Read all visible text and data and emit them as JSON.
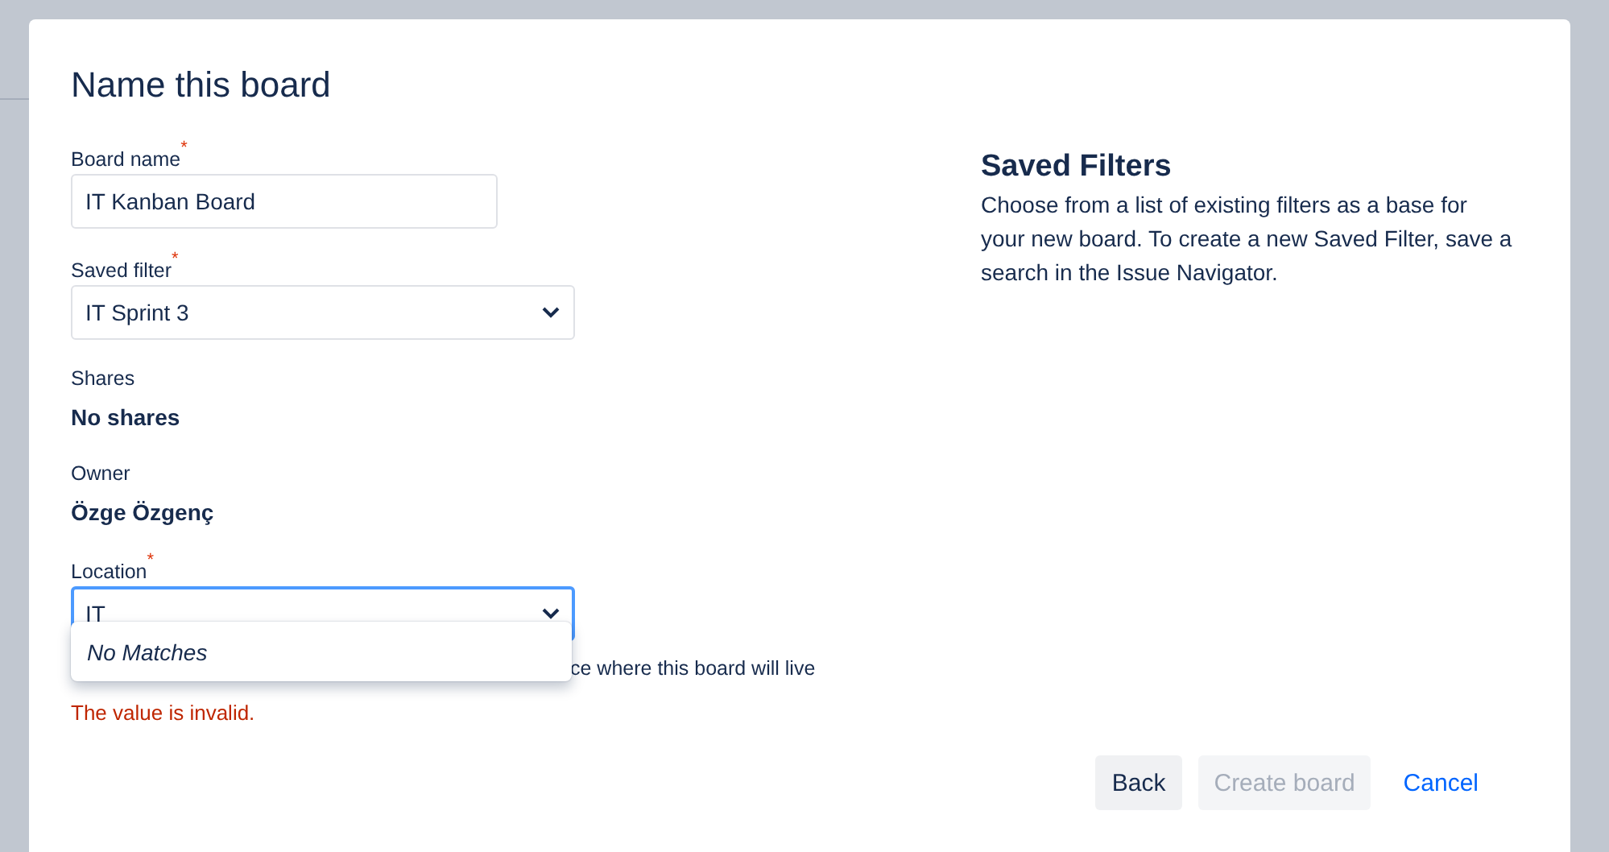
{
  "dialog": {
    "title": "Name this board"
  },
  "fields": [
    {
      "kind": "text",
      "label": "Board name",
      "marker": "*",
      "value": "IT Kanban Board"
    },
    {
      "kind": "select",
      "label": "Saved filter",
      "marker": "*",
      "value": "IT Sprint 3"
    },
    {
      "kind": "readonly",
      "label": "Shares",
      "value": "No shares"
    },
    {
      "kind": "readonly",
      "label": "Owner",
      "value": "Özge Özgenç"
    },
    {
      "kind": "select",
      "label": "Location",
      "marker": "*",
      "focused": true,
      "value": "IT",
      "dropdown": {
        "message": "No Matches"
      },
      "help": "ce where this board will live",
      "error": "The value is invalid."
    }
  ],
  "info": {
    "title": "Saved Filters",
    "text": "Choose from a list of existing filters as a base for your new board. To create a new Saved Filter, save a search in the Issue Navigator."
  },
  "buttons": [
    {
      "kind": "secondary",
      "label": "Back",
      "disabled": false
    },
    {
      "kind": "primary",
      "label": "Create board",
      "disabled": true
    },
    {
      "kind": "link",
      "label": "Cancel",
      "disabled": false
    }
  ]
}
